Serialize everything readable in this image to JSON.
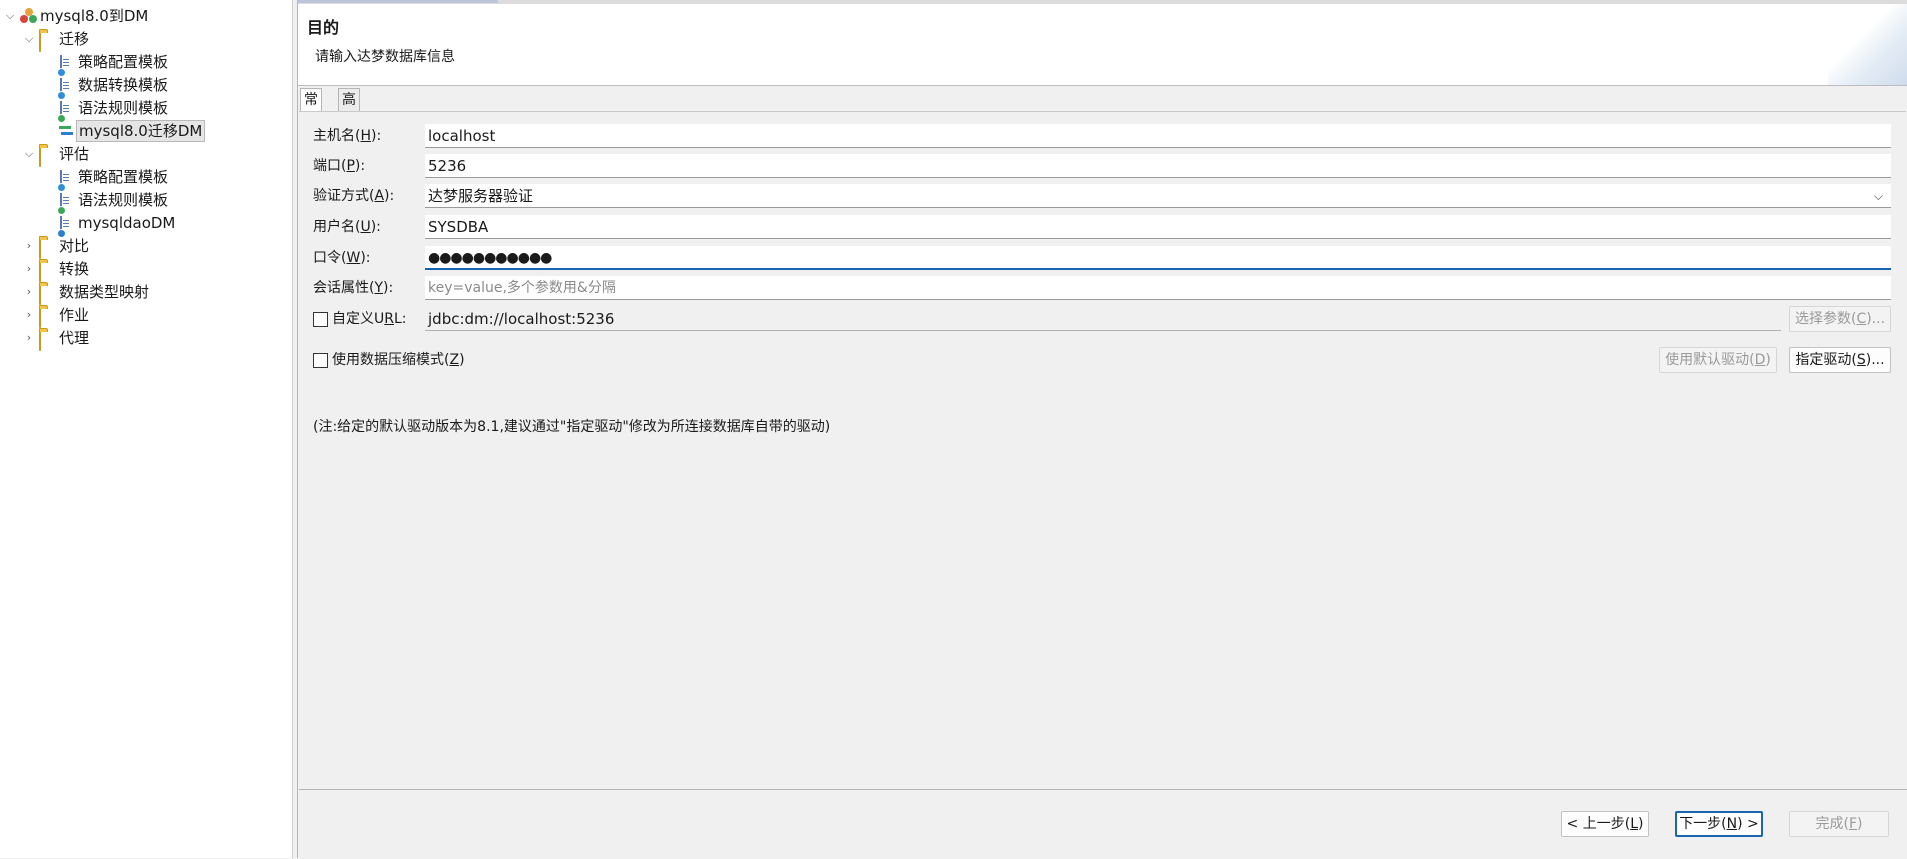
{
  "tree": {
    "root": "mysql8.0到DM",
    "migrate_folder": "迁移",
    "migrate_items": [
      "策略配置模板",
      "数据转换模板",
      "语法规则模板",
      "mysql8.0迁移DM"
    ],
    "assess_folder": "评估",
    "assess_items": [
      "策略配置模板",
      "语法规则模板",
      "mysqldaoDM"
    ],
    "folders": [
      "对比",
      "转换",
      "数据类型映射",
      "作业",
      "代理"
    ]
  },
  "header": {
    "title": "目的",
    "description": "请输入达梦数据库信息"
  },
  "tabs": [
    "常规",
    "高级"
  ],
  "form": {
    "host_label": "主机名(",
    "host_key": "H",
    "host_value": "localhost",
    "port_label": "端口(",
    "port_key": "P",
    "port_value": "5236",
    "auth_label": "验证方式(",
    "auth_key": "A",
    "auth_value": "达梦服务器验证",
    "user_label": "用户名(",
    "user_key": "U",
    "user_value": "SYSDBA",
    "pwd_label": "口令(",
    "pwd_key": "W",
    "pwd_value": "●●●●●●●●●●●",
    "session_label": "会话属性(",
    "session_key": "Y",
    "session_placeholder": "key=value,多个参数用&分隔",
    "url_label_a": "自定义U",
    "url_key": "R",
    "url_label_b": "L:",
    "url_value": "jdbc:dm://localhost:5236",
    "select_param_a": "选择参数(",
    "select_param_key": "C",
    "select_param_b": ")...",
    "compress_label": "使用数据压缩模式(",
    "compress_key": "Z",
    "default_driver_a": "使用默认驱动(",
    "default_driver_key": "D",
    "specify_driver_a": "指定驱动(",
    "specify_driver_key": "S",
    "specify_driver_b": ")...",
    "note": "(注:给定的默认驱动版本为8.1,建议通过\"指定驱动\"修改为所连接数据库自带的驱动)"
  },
  "footer": {
    "prev_a": "< 上一步(",
    "prev_key": "L",
    "next_a": "下一步(",
    "next_key": "N",
    "next_b": ") >",
    "finish_a": "完成(",
    "finish_key": "F"
  }
}
